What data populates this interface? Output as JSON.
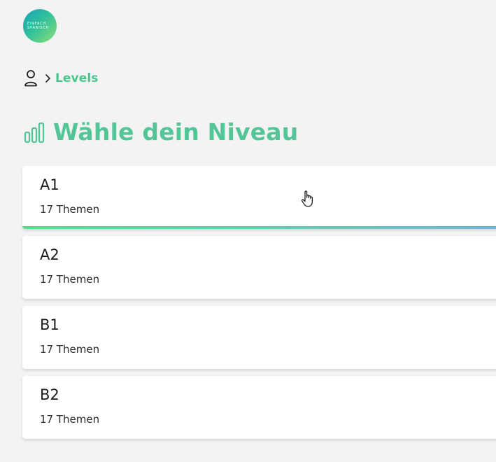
{
  "logo": {
    "line1": "EINFACH",
    "line2": "SPANISCH"
  },
  "breadcrumb": {
    "icons": [
      "user-icon",
      "chevron-right-icon"
    ],
    "current": "Levels"
  },
  "header": {
    "icon": "bar-chart-icon",
    "title": "Wähle dein Niveau"
  },
  "levels": [
    {
      "name": "A1",
      "topics": "17 Themen",
      "active": true
    },
    {
      "name": "A2",
      "topics": "17 Themen",
      "active": false
    },
    {
      "name": "B1",
      "topics": "17 Themen",
      "active": false
    },
    {
      "name": "B2",
      "topics": "17 Themen",
      "active": false
    }
  ],
  "colors": {
    "accent": "#54c596",
    "background": "#f3f3f3",
    "card": "#ffffff"
  }
}
